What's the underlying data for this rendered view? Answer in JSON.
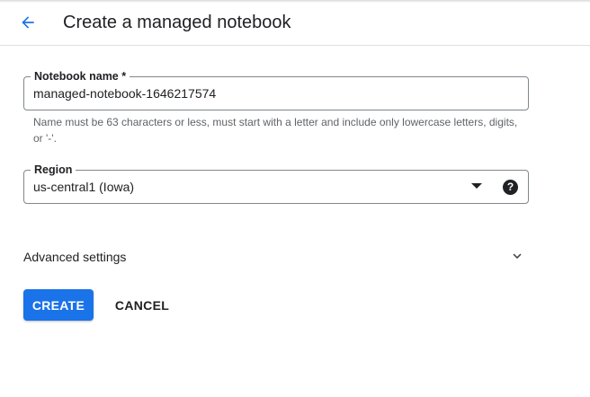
{
  "header": {
    "back_icon": "arrow-back-icon",
    "title": "Create a managed notebook"
  },
  "form": {
    "notebook_name": {
      "label": "Notebook name *",
      "value": "managed-notebook-1646217574",
      "hint": "Name must be 63 characters or less, must start with a letter and include only lowercase letters, digits, or '-'."
    },
    "region": {
      "label": "Region",
      "selected": "us-central1 (Iowa)",
      "help_icon": "help-icon",
      "help_glyph": "?"
    },
    "advanced": {
      "label": "Advanced settings",
      "icon": "chevron-down-icon"
    }
  },
  "actions": {
    "create_label": "CREATE",
    "cancel_label": "CANCEL"
  },
  "colors": {
    "accent": "#1a73e8",
    "text": "#202124",
    "hint": "#5f6368",
    "border": "#80868b"
  }
}
